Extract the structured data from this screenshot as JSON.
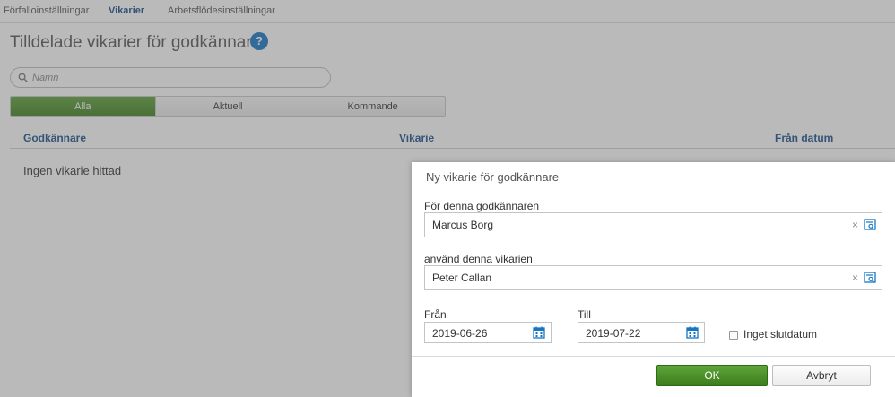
{
  "colors": {
    "accent_green": "#4a8f28",
    "link_blue": "#1a4f8b",
    "help_blue": "#1576c4",
    "overlay": "rgba(90,90,90,0.42)"
  },
  "topnav": {
    "tabs": [
      {
        "label": "Förfalloinställningar",
        "active": false
      },
      {
        "label": "Vikarier",
        "active": true
      },
      {
        "label": "Arbetsflödesinställningar",
        "active": false
      }
    ]
  },
  "page": {
    "title": "Tilldelade vikarier för godkännare",
    "help_icon": "question-circle-icon",
    "help_glyph": "?"
  },
  "search": {
    "placeholder": "Namn",
    "value": "",
    "icon": "search-icon"
  },
  "filters": {
    "tabs": [
      {
        "label": "Alla",
        "active": true
      },
      {
        "label": "Aktuell",
        "active": false
      },
      {
        "label": "Kommande",
        "active": false
      }
    ]
  },
  "table": {
    "columns": [
      "Godkännare",
      "Vikarie",
      "Från datum"
    ],
    "empty_message": "Ingen vikarie hittad"
  },
  "dialog": {
    "title": "Ny vikarie för godkännare",
    "approver": {
      "label": "För denna godkännaren",
      "value": "Marcus Borg"
    },
    "substitute": {
      "label": "använd denna vikarien",
      "value": "Peter Callan"
    },
    "clear_glyph": "×",
    "from": {
      "label": "Från",
      "value": "2019-06-26"
    },
    "to": {
      "label": "Till",
      "value": "2019-07-22"
    },
    "no_end_date": {
      "label": "Inget slutdatum",
      "checked": false
    },
    "ok_label": "OK",
    "cancel_label": "Avbryt"
  }
}
